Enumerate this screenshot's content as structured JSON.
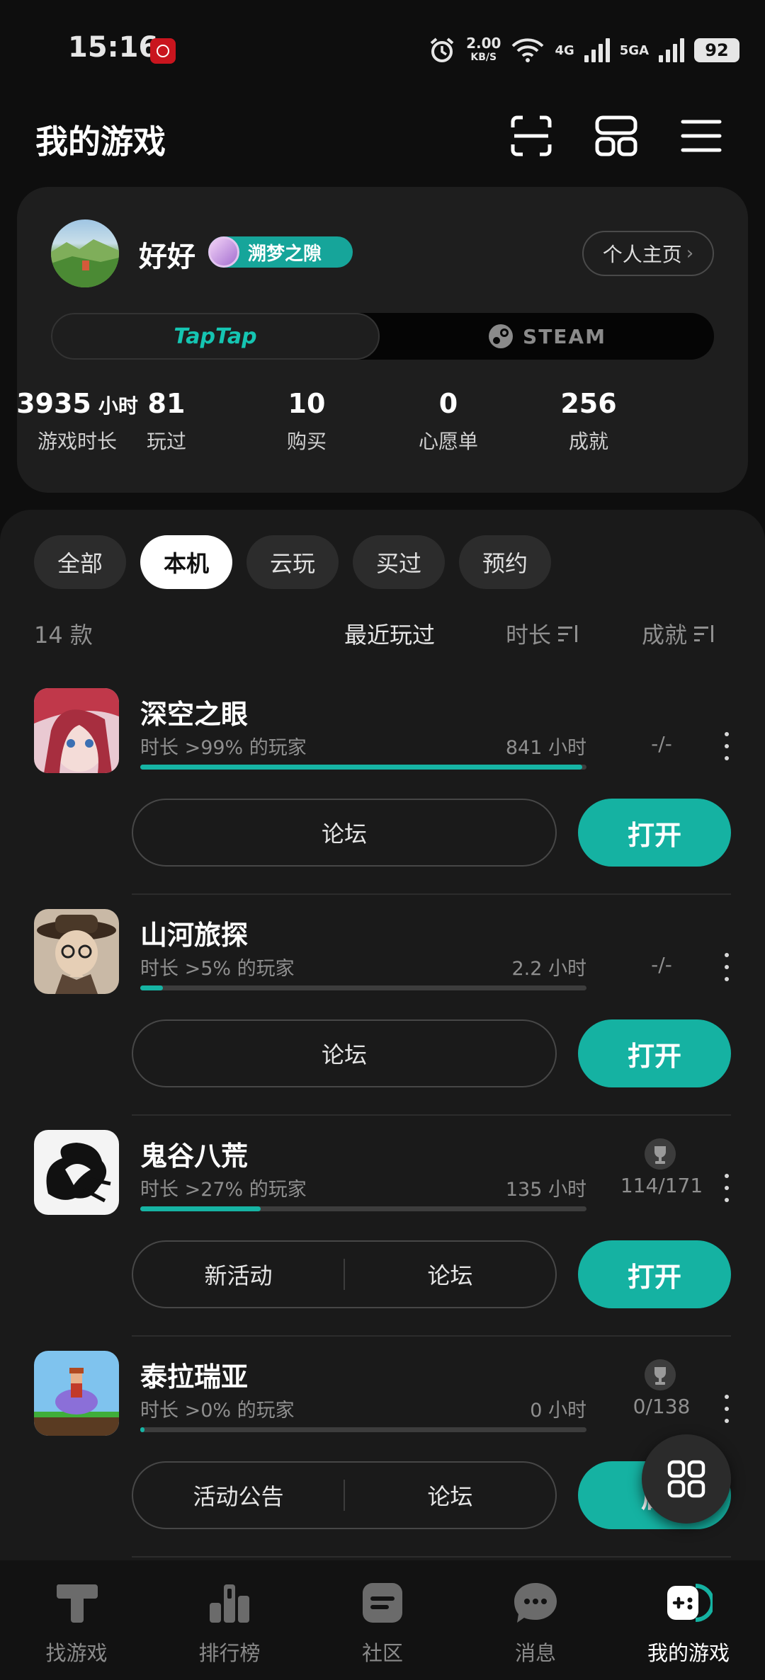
{
  "status_bar": {
    "time": "15:16",
    "speed_value": "2.00",
    "speed_unit": "KB/S",
    "net1": "4G",
    "net2": "5GA",
    "battery": "92"
  },
  "header": {
    "title": "我的游戏",
    "icons": [
      "scan-icon",
      "grid-layout-icon",
      "menu-icon"
    ]
  },
  "profile": {
    "name": "好好",
    "badge": "溯梦之隙",
    "profile_link": "个人主页",
    "platforms": {
      "taptap": "TapTap",
      "steam": "STEAM",
      "selected": "taptap"
    },
    "stats": [
      {
        "value": "3935",
        "unit": "小时",
        "label": "游戏时长"
      },
      {
        "value": "81",
        "unit": "",
        "label": "玩过"
      },
      {
        "value": "10",
        "unit": "",
        "label": "购买"
      },
      {
        "value": "0",
        "unit": "",
        "label": "心愿单"
      },
      {
        "value": "256",
        "unit": "",
        "label": "成就"
      }
    ]
  },
  "filters": {
    "chips": [
      "全部",
      "本机",
      "云玩",
      "买过",
      "预约"
    ],
    "active": "本机",
    "count": "14 款",
    "sort": {
      "recent": "最近玩过",
      "duration": "时长",
      "achievement": "成就"
    }
  },
  "games": [
    {
      "name": "深空之眼",
      "percentile": "时长 >99% 的玩家",
      "hours": "841 小时",
      "progress": 0.99,
      "achievement": "-/-",
      "has_trophy": false,
      "actions": [
        "论坛"
      ],
      "primary": "打开"
    },
    {
      "name": "山河旅探",
      "percentile": "时长 >5% 的玩家",
      "hours": "2.2 小时",
      "progress": 0.05,
      "achievement": "-/-",
      "has_trophy": false,
      "actions": [
        "论坛"
      ],
      "primary": "打开"
    },
    {
      "name": "鬼谷八荒",
      "percentile": "时长 >27% 的玩家",
      "hours": "135 小时",
      "progress": 0.27,
      "achievement": "114/171",
      "has_trophy": true,
      "actions": [
        "新活动",
        "论坛"
      ],
      "primary": "打开"
    },
    {
      "name": "泰拉瑞亚",
      "percentile": "时长 >0% 的玩家",
      "hours": "0 小时",
      "progress": 0.01,
      "achievement": "0/138",
      "has_trophy": true,
      "actions": [
        "活动公告",
        "论坛"
      ],
      "primary": "启"
    }
  ],
  "bottom_nav": {
    "items": [
      {
        "label": "找游戏",
        "icon": "find-game-icon"
      },
      {
        "label": "排行榜",
        "icon": "leaderboard-icon"
      },
      {
        "label": "社区",
        "icon": "community-icon"
      },
      {
        "label": "消息",
        "icon": "message-icon"
      },
      {
        "label": "我的游戏",
        "icon": "my-games-icon"
      }
    ],
    "active": "我的游戏"
  },
  "colors": {
    "accent": "#15b2a2",
    "background": "#0e0e0e",
    "card": "#1e1e1e"
  }
}
